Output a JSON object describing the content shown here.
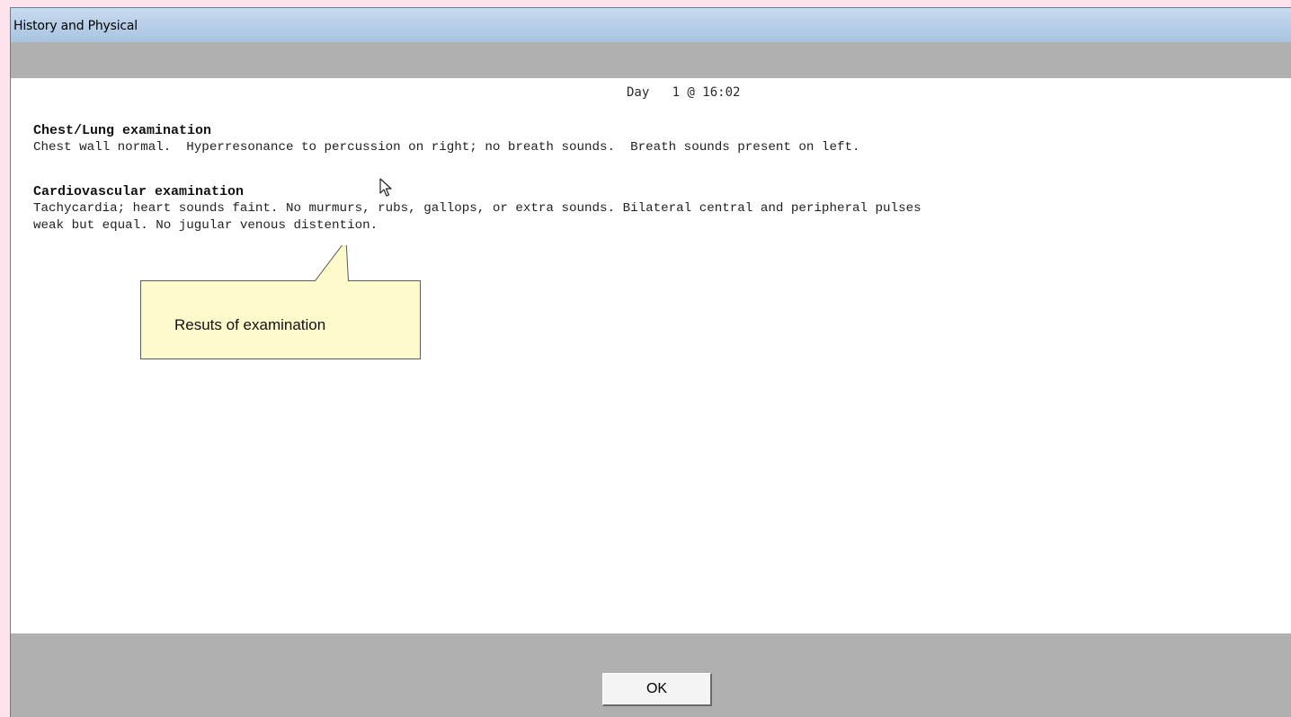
{
  "window": {
    "title": "History and Physical"
  },
  "report": {
    "timestamp": "Day   1 @ 16:02",
    "sections": [
      {
        "heading": "Chest/Lung examination",
        "lines": [
          "Chest wall normal.  Hyperresonance to percussion on right; no breath sounds.  Breath sounds present on left."
        ]
      },
      {
        "heading": "Cardiovascular examination",
        "lines": [
          "Tachycardia; heart sounds faint. No murmurs, rubs, gallops, or extra sounds. Bilateral central and peripheral pulses",
          "weak but equal. No jugular venous distention."
        ]
      }
    ]
  },
  "callout": {
    "text": "Resuts of examination",
    "fill_color": "#fdfacb",
    "border_color": "#5a5a5a"
  },
  "footer": {
    "ok_label": "OK"
  },
  "icons": {
    "cursor": "mouse-pointer-icon"
  },
  "colors": {
    "titlebar": "#b9d0e8",
    "panel_gray": "#b0b0b0",
    "background": "#fde4ec"
  }
}
